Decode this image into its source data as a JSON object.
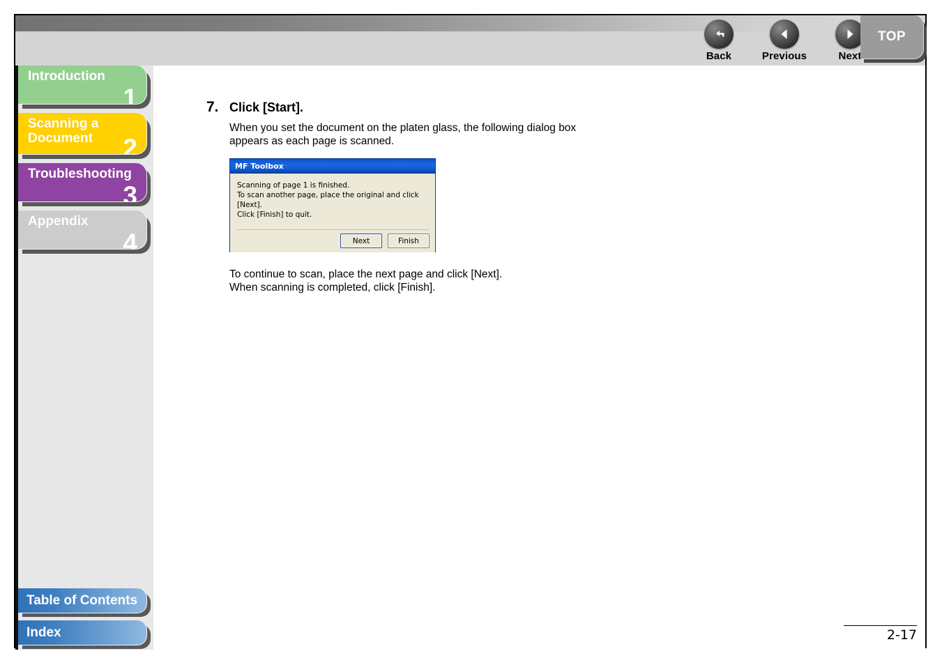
{
  "header": {
    "nav_buttons": [
      {
        "label": "Back",
        "icon": "back-arrow-icon"
      },
      {
        "label": "Previous",
        "icon": "left-triangle-icon"
      },
      {
        "label": "Next",
        "icon": "right-triangle-icon"
      }
    ],
    "top_tab_label": "TOP"
  },
  "sidebar": {
    "chapters": [
      {
        "label": "Introduction",
        "number": "1",
        "color": "#93d08f"
      },
      {
        "label": "Scanning a Document",
        "number": "2",
        "color": "#ffd100"
      },
      {
        "label": "Troubleshooting",
        "number": "3",
        "color": "#8e44a0"
      },
      {
        "label": "Appendix",
        "number": "4",
        "color": "#cccccc"
      }
    ],
    "bottom_links": [
      {
        "label": "Table of Contents"
      },
      {
        "label": "Index"
      }
    ]
  },
  "content": {
    "step_number": "7.",
    "step_title": "Click [Start].",
    "step_body": "When you set the document on the platen glass, the following dialog box appears as each page is scanned.",
    "closing_text": "To continue to scan, place the next page and click [Next]. When scanning is completed, click [Finish]."
  },
  "dialog": {
    "title": "MF Toolbox",
    "line1": "Scanning of page 1 is finished.",
    "line2": "To scan another page, place the original and click [Next].",
    "line3": "Click [Finish] to quit.",
    "button_next": "Next",
    "button_finish": "Finish"
  },
  "footer": {
    "page_number": "2-17"
  }
}
